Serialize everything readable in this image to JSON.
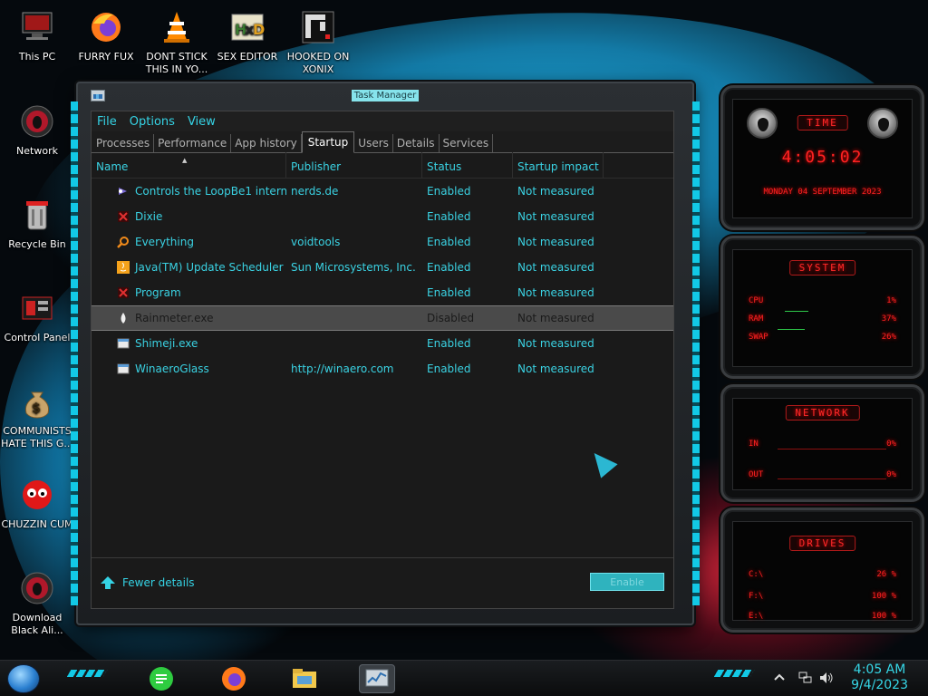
{
  "desktop": {
    "icons": [
      {
        "label": "This PC",
        "icon": "computer-icon"
      },
      {
        "label": "FURRY FUX",
        "icon": "firefox-icon"
      },
      {
        "label": "DONT STICK THIS IN YO...",
        "icon": "vlc-cone-icon"
      },
      {
        "label": "SEX EDITOR",
        "icon": "hxd-editor-icon"
      },
      {
        "label": "HOOKED ON XONIX",
        "icon": "xonix-game-icon"
      },
      {
        "label": "Network",
        "icon": "alien-network-icon"
      },
      {
        "label": "Recycle Bin",
        "icon": "recycle-bin-icon"
      },
      {
        "label": "Control Panel",
        "icon": "control-panel-icon"
      },
      {
        "label": "COMMUNISTS HATE THIS G...",
        "icon": "money-bag-icon"
      },
      {
        "label": "CHUZZIN CUM",
        "icon": "chuzzle-icon"
      },
      {
        "label": "Download Black Ali...",
        "icon": "alien-download-icon"
      }
    ]
  },
  "task_manager": {
    "title": "Task Manager",
    "menu": [
      "File",
      "Options",
      "View"
    ],
    "tabs": [
      "Processes",
      "Performance",
      "App history",
      "Startup",
      "Users",
      "Details",
      "Services"
    ],
    "active_tab": "Startup",
    "columns": [
      "Name",
      "Publisher",
      "Status",
      "Startup impact"
    ],
    "rows": [
      {
        "name": "Controls the LoopBe1 intern...",
        "publisher": "nerds.de",
        "status": "Enabled",
        "impact": "Not measured",
        "icon": "loopbe-icon"
      },
      {
        "name": "Dixie",
        "publisher": "",
        "status": "Enabled",
        "impact": "Not measured",
        "icon": "app-red-icon"
      },
      {
        "name": "Everything",
        "publisher": "voidtools",
        "status": "Enabled",
        "impact": "Not measured",
        "icon": "magnifier-icon"
      },
      {
        "name": "Java(TM) Update Scheduler",
        "publisher": "Sun Microsystems, Inc.",
        "status": "Enabled",
        "impact": "Not measured",
        "icon": "java-icon"
      },
      {
        "name": "Program",
        "publisher": "",
        "status": "Enabled",
        "impact": "Not measured",
        "icon": "app-red-icon"
      },
      {
        "name": "Rainmeter.exe",
        "publisher": "",
        "status": "Disabled",
        "impact": "Not measured",
        "icon": "rainmeter-drop-icon",
        "selected": true
      },
      {
        "name": "Shimeji.exe",
        "publisher": "",
        "status": "Enabled",
        "impact": "Not measured",
        "icon": "window-icon"
      },
      {
        "name": "WinaeroGlass",
        "publisher": "http://winaero.com",
        "status": "Enabled",
        "impact": "Not measured",
        "icon": "window-icon"
      }
    ],
    "fewer_details": "Fewer details",
    "enable_button": "Enable"
  },
  "rainmeter": {
    "time": {
      "title": "TIME",
      "clock": "4:05:02",
      "date": "MONDAY 04 SEPTEMBER 2023"
    },
    "system": {
      "title": "SYSTEM",
      "stats": [
        {
          "label": "CPU",
          "value": "1%"
        },
        {
          "label": "RAM",
          "value": "37%"
        },
        {
          "label": "SWAP",
          "value": "26%"
        }
      ]
    },
    "network": {
      "title": "NETWORK",
      "stats": [
        {
          "label": "IN",
          "value": "0%"
        },
        {
          "label": "OUT",
          "value": "0%"
        }
      ]
    },
    "drives": {
      "title": "DRIVES",
      "stats": [
        {
          "label": "C:\\",
          "value": "26 %"
        },
        {
          "label": "F:\\",
          "value": "100 %"
        },
        {
          "label": "E:\\",
          "value": "100 %"
        }
      ]
    }
  },
  "taskbar": {
    "pinned": [
      "whatsapp-style-chat-icon",
      "firefox-icon",
      "file-explorer-icon",
      "task-manager-icon"
    ],
    "clock_time": "4:05 AM",
    "clock_date": "9/4/2023"
  },
  "colors": {
    "accent": "#35d3e5",
    "rainmeter_red": "#ff2222"
  }
}
